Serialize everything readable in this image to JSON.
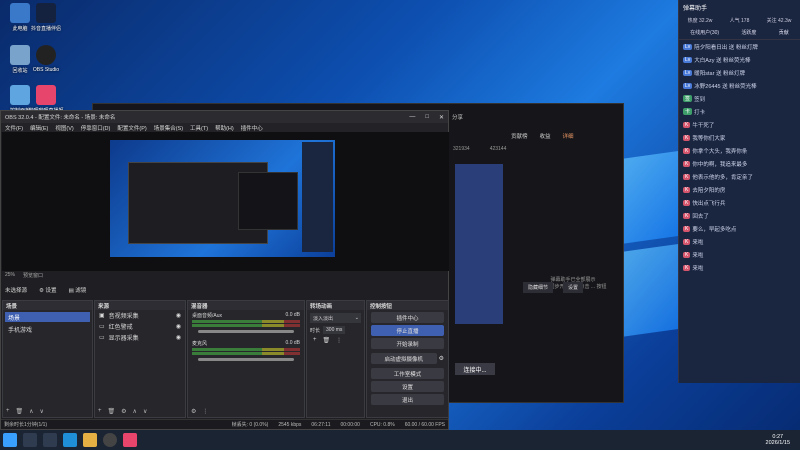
{
  "desktop": {
    "icons": [
      "此电脑",
      "抖音直播伴侣",
      "回收站",
      "OBS Studio",
      "控制面板",
      "哔哩哔哩直播姬"
    ]
  },
  "video_app": {
    "tabs": [
      "开播",
      "分享"
    ],
    "contrib": "贡献榜",
    "earn": "收益",
    "view": "详细",
    "stat1": "321934",
    "stat2": "423144",
    "connect": "连接中...",
    "lbl_mute": "隐藏细节",
    "lbl_set": "设置",
    "info": "弹幕助手已全部展示",
    "hint": "若想同步开启，请点击 ... 按钮"
  },
  "danmu": {
    "title": "弹幕助手",
    "stats": {
      "hot": "热度 32.2w",
      "pop": "人气 178",
      "follow": "关注 42.3w"
    },
    "tabs": [
      "在线用户(30)",
      "活跃度",
      "贡献"
    ],
    "rows": [
      "陪夕阳看日出 送 粉丝灯牌",
      "大白Azy 送 粉丝荧光棒",
      "暖阳star 送 粉丝灯牌",
      "冰野26445 送 粉丝荧光棒",
      "签到",
      "打卡",
      "牛干死了",
      "我等你们大家",
      "你拿个大头，我弄你条",
      "你中的啊，我追来最多",
      "他表示他的多，肯定亲了",
      "去陪夕阳的房",
      "快出点飞行兵",
      "回去了",
      "要么，早起多吃点",
      "来啦",
      "来啦",
      "来啦"
    ]
  },
  "obs": {
    "title": "OBS 32.0.4 - 配置文件: 未命名 - 场景: 未命名",
    "menu": [
      "文件(F)",
      "编辑(E)",
      "视图(V)",
      "停靠窗口(D)",
      "配置文件(P)",
      "场景集合(S)",
      "工具(T)",
      "帮助(H)",
      "插件中心"
    ],
    "zoom": "25%",
    "preview_label": "预览窗口",
    "no_source": "未选择源",
    "tabs_props": [
      "设置",
      "滤镜"
    ],
    "docks": {
      "scenes": "场景",
      "sources": "来源",
      "mixer": "混音器",
      "transitions": "转场动画",
      "controls": "控制按钮"
    },
    "scene_items": [
      "场景",
      "手机游戏"
    ],
    "source_items": [
      "音视频采集",
      "红色警戒",
      "显示器采集"
    ],
    "mixer_items": [
      {
        "name": "桌面音频/Aux",
        "db": "0.0 dB"
      },
      {
        "name": "麦克风",
        "db": "0.0 dB"
      }
    ],
    "transition": {
      "type": "淡入淡出",
      "dur_label": "时长",
      "dur": "300 ms"
    },
    "controls": [
      "插件中心",
      "停止直播",
      "开始录制",
      "启动虚拟摄像机",
      "工作室模式",
      "设置",
      "退出"
    ],
    "status": [
      "帧丢失: 0 (0.0%)",
      "2545 kbps",
      "06:27:11",
      "00:00:00",
      "CPU: 0.8%",
      "60.00 / 60.00 FPS"
    ],
    "tip": "剩余时长1分钟(1/1)"
  },
  "taskbar": {
    "time": "0:27",
    "date": "2026/1/15"
  }
}
